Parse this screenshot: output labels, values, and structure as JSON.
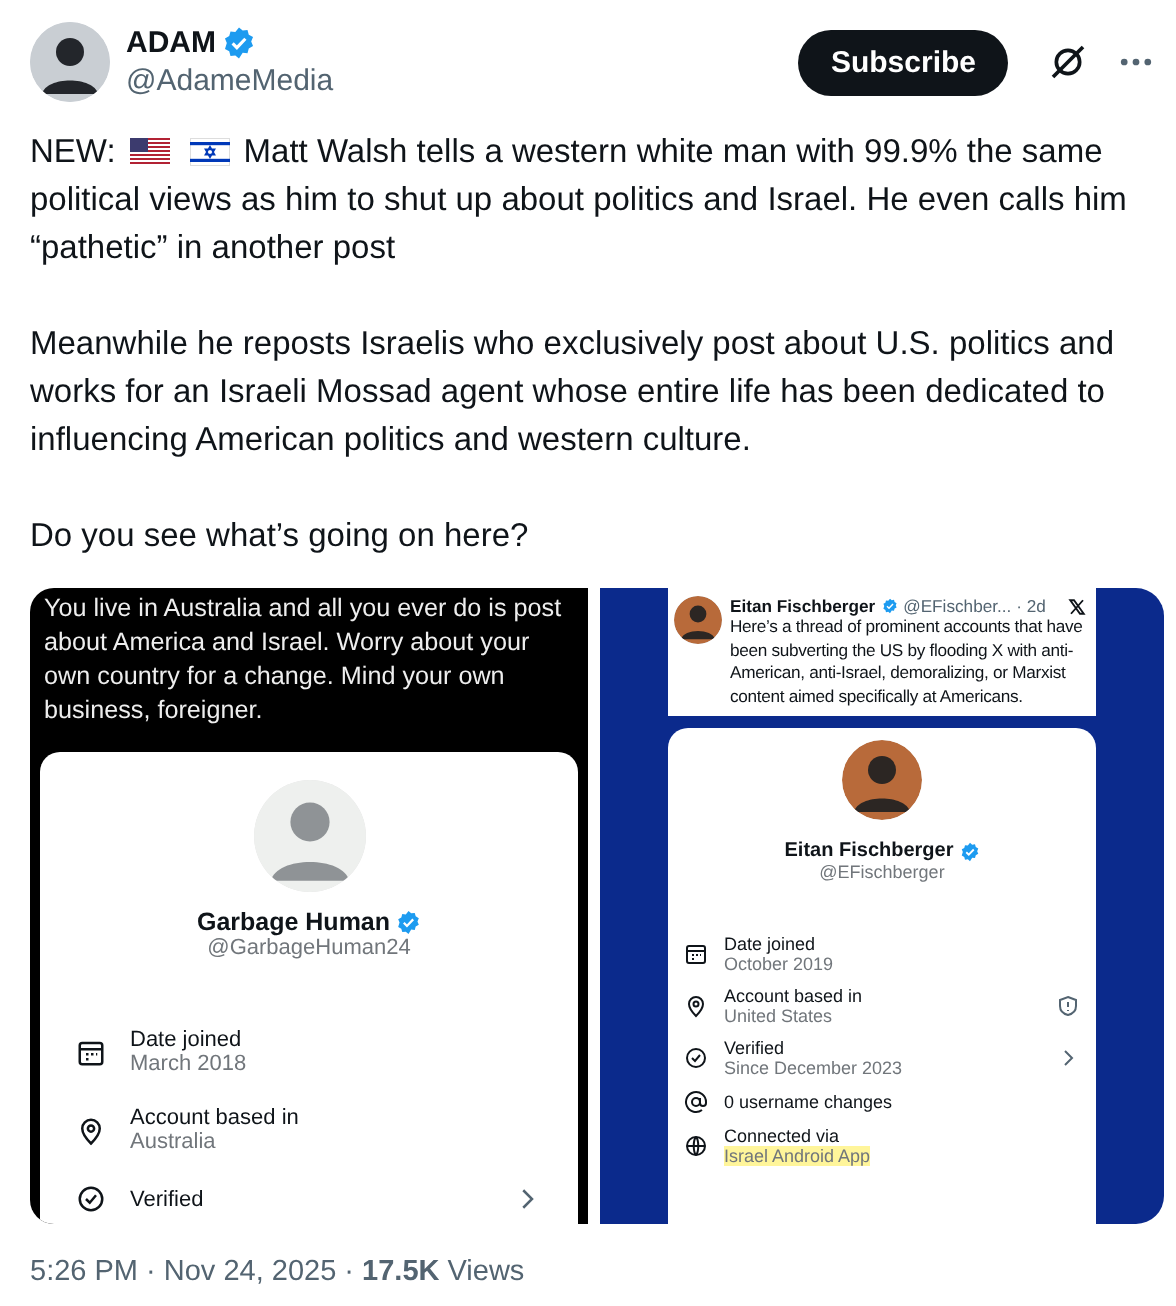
{
  "author": {
    "name": "ADAM",
    "handle": "@AdameMedia",
    "verified": true
  },
  "subscribe_button": "Subscribe",
  "post": {
    "lead": "NEW:",
    "first_line": "Matt Walsh tells a western white man with 99.9% the same",
    "first_paragraph_rest": "political views as him to shut up about politics and Israel. He even calls him “pathetic” in another post",
    "paragraphs": [
      "Meanwhile he reposts Israelis who exclusively post about U.S. politics and works for an Israeli Mossad agent whose entire life has been dedicated to influencing American politics and western culture.",
      "Do you see what’s going on here?"
    ]
  },
  "screenshots": [
    {
      "kind": "reply",
      "quote": "You live in Australia and all you ever do is post about America and Israel. Worry about your own country for a change. Mind your own business, foreigner.",
      "profile": {
        "name": "Garbage Human",
        "verified": true,
        "handle": "@GarbageHuman24",
        "rows": [
          {
            "kind": "date",
            "label": "Date joined",
            "value": "March 2018",
            "highlighted": false
          },
          {
            "kind": "location",
            "label": "Account based in",
            "value": "Australia",
            "highlighted": false
          },
          {
            "kind": "verified",
            "label": "Verified",
            "accessory": {
              "kind": "chevron"
            },
            "highlighted": false
          }
        ]
      }
    },
    {
      "kind": "repost",
      "tweet": {
        "name": "Eitan Fischberger",
        "verified": true,
        "meta": "@EFischber... · 2d",
        "text": "Here’s a thread of prominent accounts that have been subverting the US by flooding X with anti-American, anti-Israel, demoralizing, or Marxist content aimed specifically at Americans."
      },
      "profile": {
        "name": "Eitan Fischberger",
        "verified": true,
        "handle": "@EFischberger",
        "rows": [
          {
            "kind": "date",
            "label": "Date joined",
            "value": "October 2019",
            "highlighted": false
          },
          {
            "kind": "location",
            "label": "Account based in",
            "value": "United States",
            "accessory": {
              "kind": "info"
            },
            "highlighted": false
          },
          {
            "kind": "verified",
            "label": "Verified",
            "value": "Since December 2023",
            "accessory": {
              "kind": "chevron"
            },
            "highlighted": false
          },
          {
            "kind": "username",
            "label": "0 username changes",
            "highlighted": false
          },
          {
            "kind": "connection",
            "label": "Connected via",
            "value": "Israel Android App",
            "highlighted": true
          }
        ]
      }
    }
  ],
  "footer": "5:26 PM · Nov 24, 2025 · **17.5K** Views"
}
